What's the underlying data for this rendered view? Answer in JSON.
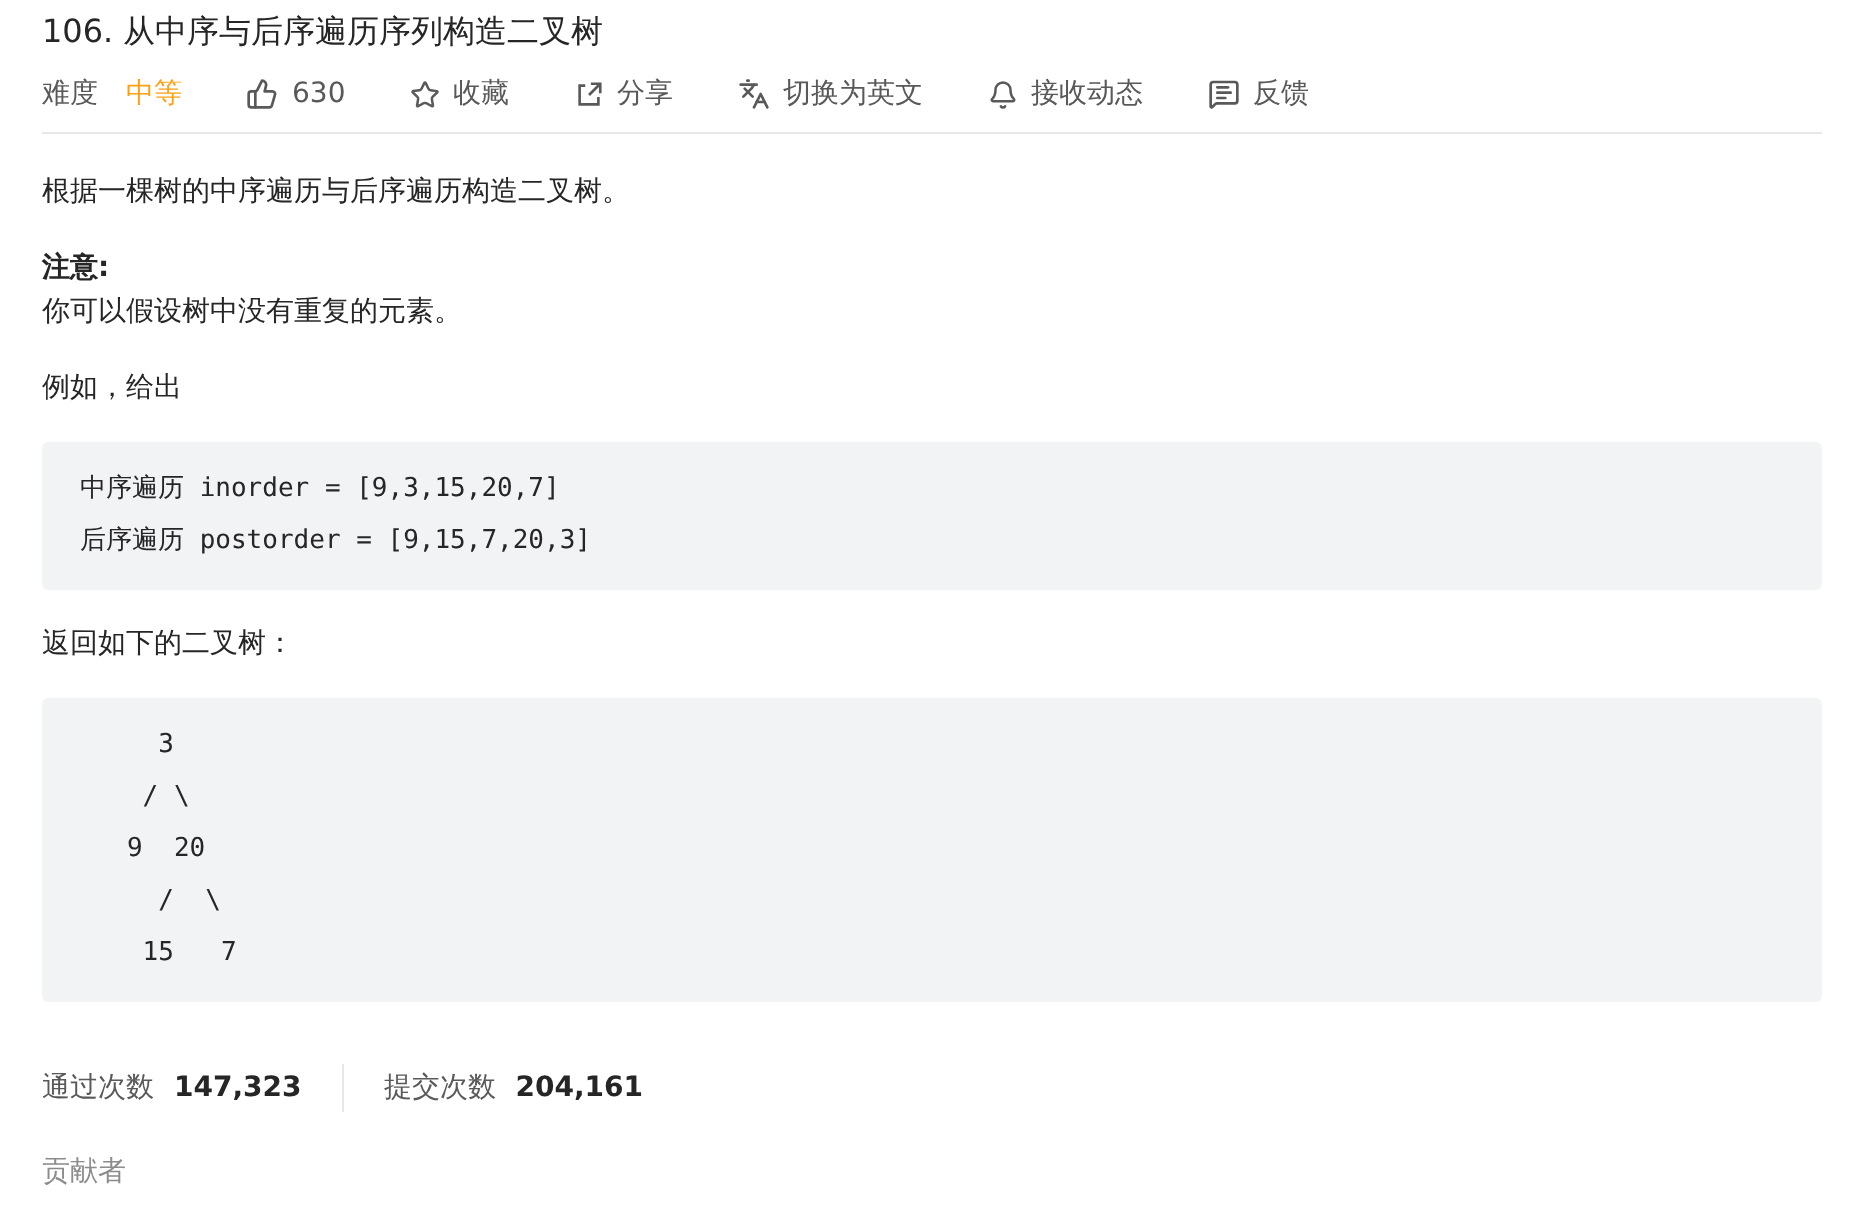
{
  "title": "106. 从中序与后序遍历序列构造二叉树",
  "meta": {
    "difficulty_label": "难度",
    "difficulty": "中等",
    "actions": [
      {
        "kind": "like",
        "label": "630"
      },
      {
        "kind": "star",
        "label": "收藏"
      },
      {
        "kind": "share",
        "label": "分享"
      },
      {
        "kind": "translate",
        "label": "切换为英文"
      },
      {
        "kind": "bell",
        "label": "接收动态"
      },
      {
        "kind": "feedback",
        "label": "反馈"
      }
    ]
  },
  "content": [
    {
      "kind": "paragraph",
      "text": "根据一棵树的中序遍历与后序遍历构造二叉树。"
    },
    {
      "kind": "note",
      "title": "注意:",
      "text": "你可以假设树中没有重复的元素。"
    },
    {
      "kind": "paragraph",
      "text": "例如，给出"
    },
    {
      "kind": "code",
      "lines": [
        "中序遍历 inorder = [9,3,15,20,7]",
        "后序遍历 postorder = [9,15,7,20,3]"
      ]
    },
    {
      "kind": "paragraph",
      "text": "返回如下的二叉树："
    },
    {
      "kind": "code",
      "lines": [
        "     3",
        "    / \\",
        "   9  20",
        "     /  \\",
        "    15   7"
      ]
    }
  ],
  "stats": [
    {
      "label": "通过次数",
      "value": "147,323"
    },
    {
      "label": "提交次数",
      "value": "204,161"
    }
  ],
  "contributors_label": "贡献者"
}
